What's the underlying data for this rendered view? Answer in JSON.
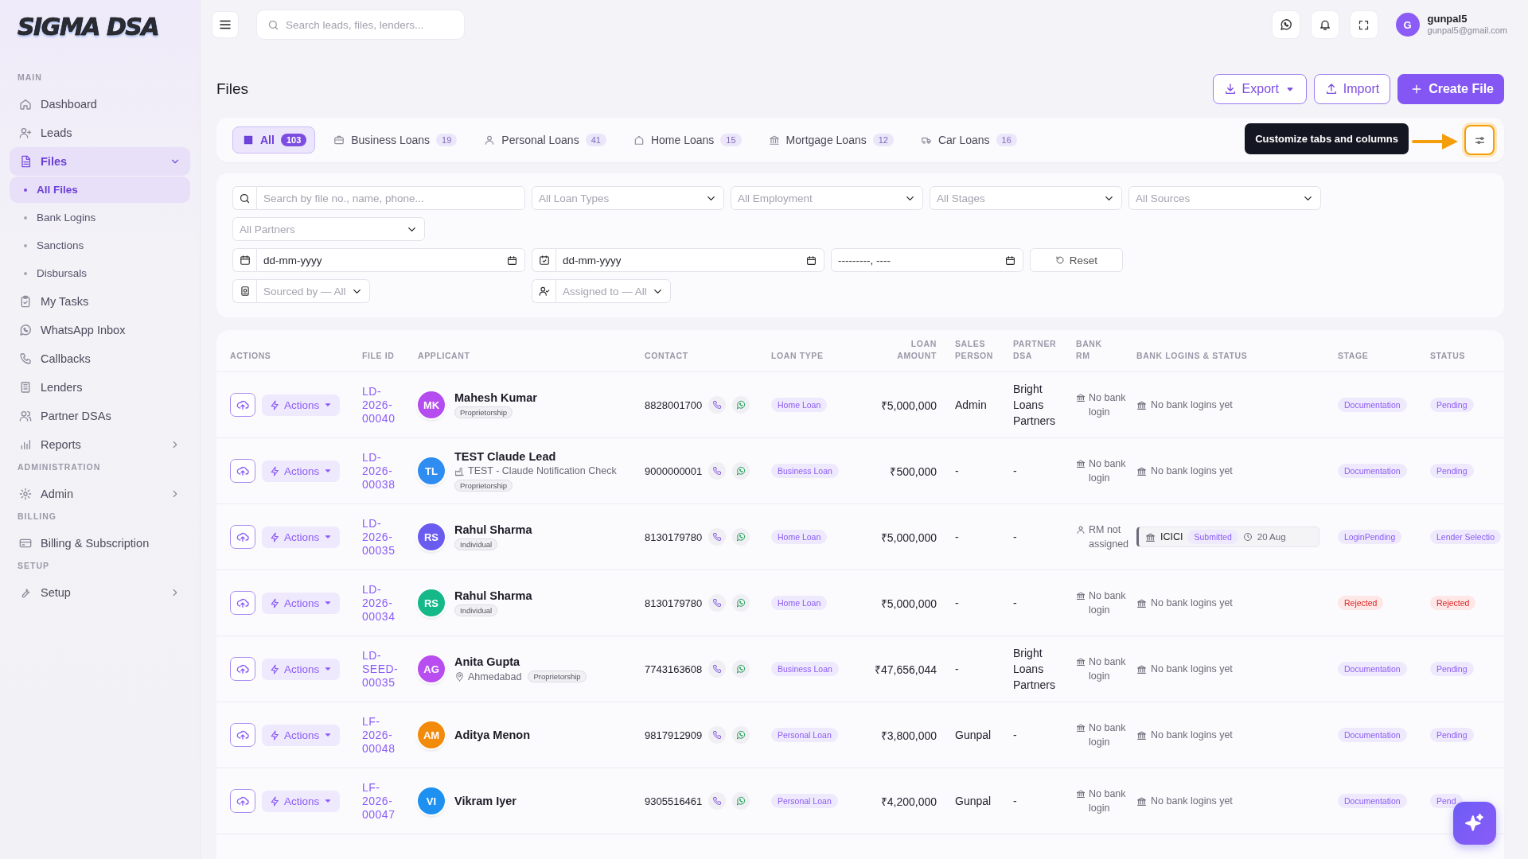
{
  "logo": {
    "text": "SIGMA DSA"
  },
  "sidebar": {
    "sections": [
      {
        "heading": "MAIN",
        "items": [
          {
            "label": "Dashboard",
            "selected": false
          },
          {
            "label": "Leads",
            "selected": false
          },
          {
            "label": "Files",
            "selected": true,
            "expanded": true,
            "children": [
              {
                "label": "All Files",
                "selected": true
              },
              {
                "label": "Bank Logins",
                "selected": false
              },
              {
                "label": "Sanctions",
                "selected": false
              },
              {
                "label": "Disbursals",
                "selected": false
              }
            ]
          },
          {
            "label": "My Tasks",
            "selected": false
          },
          {
            "label": "WhatsApp Inbox",
            "selected": false
          },
          {
            "label": "Callbacks",
            "selected": false
          },
          {
            "label": "Lenders",
            "selected": false
          },
          {
            "label": "Partner DSAs",
            "selected": false
          },
          {
            "label": "Reports",
            "selected": false,
            "expanded": false
          }
        ]
      },
      {
        "heading": "ADMINISTRATION",
        "items": [
          {
            "label": "Admin",
            "selected": false,
            "expanded": false
          }
        ]
      },
      {
        "heading": "BILLING",
        "items": [
          {
            "label": "Billing & Subscription",
            "selected": false
          }
        ]
      },
      {
        "heading": "SETUP",
        "items": [
          {
            "label": "Setup",
            "selected": false,
            "expanded": false
          }
        ]
      }
    ]
  },
  "topbar": {
    "search": {
      "placeholder": "Search leads, files, lenders..."
    },
    "user": {
      "initial": "G",
      "name": "gunpal5",
      "email": "gunpal5@gmail.com"
    }
  },
  "header": {
    "title": "Files",
    "buttons": [
      {
        "label": "Export",
        "kind": "dropdown"
      },
      {
        "label": "Import",
        "kind": "outline"
      },
      {
        "label": "Create File",
        "kind": "primary"
      }
    ]
  },
  "tabs": {
    "items": [
      {
        "label": "All",
        "count": "103",
        "selected": true
      },
      {
        "label": "Business Loans",
        "count": "19",
        "selected": false
      },
      {
        "label": "Personal Loans",
        "count": "41",
        "selected": false
      },
      {
        "label": "Home Loans",
        "count": "15",
        "selected": false
      },
      {
        "label": "Mortgage Loans",
        "count": "12",
        "selected": false
      },
      {
        "label": "Car Loans",
        "count": "16",
        "selected": false
      }
    ],
    "tooltip": "Customize tabs and columns"
  },
  "filters": {
    "search": {
      "placeholder": "Search by file no., name, phone..."
    },
    "selects": [
      {
        "placeholder": "All Loan Types"
      },
      {
        "placeholder": "All Employment"
      },
      {
        "placeholder": "All Stages"
      },
      {
        "placeholder": "All Sources"
      },
      {
        "placeholder": "All Partners"
      }
    ],
    "dates": [
      {
        "placeholder": "dd-mm-yyyy"
      },
      {
        "placeholder": "dd-mm-yyyy"
      },
      {
        "placeholder": "---------, ----"
      }
    ],
    "reset": "Reset",
    "people": [
      {
        "placeholder": "Sourced by — All"
      },
      {
        "placeholder": "Assigned to — All"
      }
    ]
  },
  "table": {
    "columns": [
      "ACTIONS",
      "FILE ID",
      "APPLICANT",
      "CONTACT",
      "LOAN TYPE",
      "LOAN AMOUNT",
      "SALES PERSON",
      "PARTNER DSA",
      "BANK RM",
      "BANK LOGINS & STATUS",
      "STAGE",
      "STATUS"
    ],
    "rows": [
      {
        "action": "Actions",
        "file_id": "LD-2026-00040",
        "initials": "MK",
        "color": "#b44cf0",
        "name": "Mahesh Kumar",
        "details": [
          {
            "kind": "tag",
            "text": "Proprietorship"
          }
        ],
        "contact": "8828001700",
        "loan_type": "Home Loan",
        "amount": "₹5,000,000",
        "sales_person": "Admin",
        "partner_dsa": "Bright Loans Partners",
        "bank_rm": {
          "kind": "bank",
          "text": "No bank login"
        },
        "bank_logins": {
          "kind": "none",
          "text": "No bank logins yet"
        },
        "stage": {
          "text": "Documentation",
          "kind": "normal"
        },
        "status": {
          "text": "Pending",
          "kind": "normal"
        }
      },
      {
        "action": "Actions",
        "file_id": "LD-2026-00038",
        "initials": "TL",
        "color": "#2f8cf0",
        "name": "TEST Claude Lead",
        "details": [
          {
            "kind": "company",
            "text": "TEST - Claude Notification Check"
          },
          {
            "kind": "tag",
            "text": "Proprietorship"
          }
        ],
        "contact": "9000000001",
        "loan_type": "Business Loan",
        "amount": "₹500,000",
        "sales_person": "-",
        "partner_dsa": "-",
        "bank_rm": {
          "kind": "bank",
          "text": "No bank login"
        },
        "bank_logins": {
          "kind": "none",
          "text": "No bank logins yet"
        },
        "stage": {
          "text": "Documentation",
          "kind": "normal"
        },
        "status": {
          "text": "Pending",
          "kind": "normal"
        }
      },
      {
        "action": "Actions",
        "file_id": "LD-2026-00035",
        "initials": "RS",
        "color": "#6a5cf0",
        "name": "Rahul Sharma",
        "details": [
          {
            "kind": "tag",
            "text": "Individual"
          }
        ],
        "contact": "8130179780",
        "loan_type": "Home Loan",
        "amount": "₹5,000,000",
        "sales_person": "-",
        "partner_dsa": "-",
        "bank_rm": {
          "kind": "person",
          "text": "RM not assigned"
        },
        "bank_logins": {
          "kind": "login",
          "bank": "ICICI",
          "status": "Submitted",
          "date": "20 Aug"
        },
        "stage": {
          "text": "LoginPending",
          "kind": "normal"
        },
        "status": {
          "text": "Lender Selectio",
          "kind": "normal"
        }
      },
      {
        "action": "Actions",
        "file_id": "LD-2026-00034",
        "initials": "RS",
        "color": "#14b889",
        "name": "Rahul Sharma",
        "details": [
          {
            "kind": "tag",
            "text": "Individual"
          }
        ],
        "contact": "8130179780",
        "loan_type": "Home Loan",
        "amount": "₹5,000,000",
        "sales_person": "-",
        "partner_dsa": "-",
        "bank_rm": {
          "kind": "bank",
          "text": "No bank login"
        },
        "bank_logins": {
          "kind": "none",
          "text": "No bank logins yet"
        },
        "stage": {
          "text": "Rejected",
          "kind": "rejected"
        },
        "status": {
          "text": "Rejected",
          "kind": "rejected"
        }
      },
      {
        "action": "Actions",
        "file_id": "LD-SEED-00035",
        "initials": "AG",
        "color": "#b94ef0",
        "name": "Anita Gupta",
        "details": [
          {
            "kind": "location",
            "text": "Ahmedabad"
          },
          {
            "kind": "tag",
            "text": "Proprietorship"
          }
        ],
        "contact": "7743163608",
        "loan_type": "Business Loan",
        "amount": "₹47,656,044",
        "sales_person": "-",
        "partner_dsa": "Bright Loans Partners",
        "bank_rm": {
          "kind": "bank",
          "text": "No bank login"
        },
        "bank_logins": {
          "kind": "none",
          "text": "No bank logins yet"
        },
        "stage": {
          "text": "Documentation",
          "kind": "normal"
        },
        "status": {
          "text": "Pending",
          "kind": "normal"
        }
      },
      {
        "action": "Actions",
        "file_id": "LF-2026-00048",
        "initials": "AM",
        "color": "#f28a0c",
        "name": "Aditya Menon",
        "details": [],
        "contact": "9817912909",
        "loan_type": "Personal Loan",
        "amount": "₹3,800,000",
        "sales_person": "Gunpal",
        "partner_dsa": "-",
        "bank_rm": {
          "kind": "bank",
          "text": "No bank login"
        },
        "bank_logins": {
          "kind": "none",
          "text": "No bank logins yet"
        },
        "stage": {
          "text": "Documentation",
          "kind": "normal"
        },
        "status": {
          "text": "Pending",
          "kind": "normal"
        }
      },
      {
        "action": "Actions",
        "file_id": "LF-2026-00047",
        "initials": "VI",
        "color": "#1e90f0",
        "name": "Vikram Iyer",
        "details": [],
        "contact": "9305516461",
        "loan_type": "Personal Loan",
        "amount": "₹4,200,000",
        "sales_person": "Gunpal",
        "partner_dsa": "-",
        "bank_rm": {
          "kind": "bank",
          "text": "No bank login"
        },
        "bank_logins": {
          "kind": "none",
          "text": "No bank logins yet"
        },
        "stage": {
          "text": "Documentation",
          "kind": "normal"
        },
        "status": {
          "text": "Pend",
          "kind": "normal"
        }
      }
    ]
  }
}
